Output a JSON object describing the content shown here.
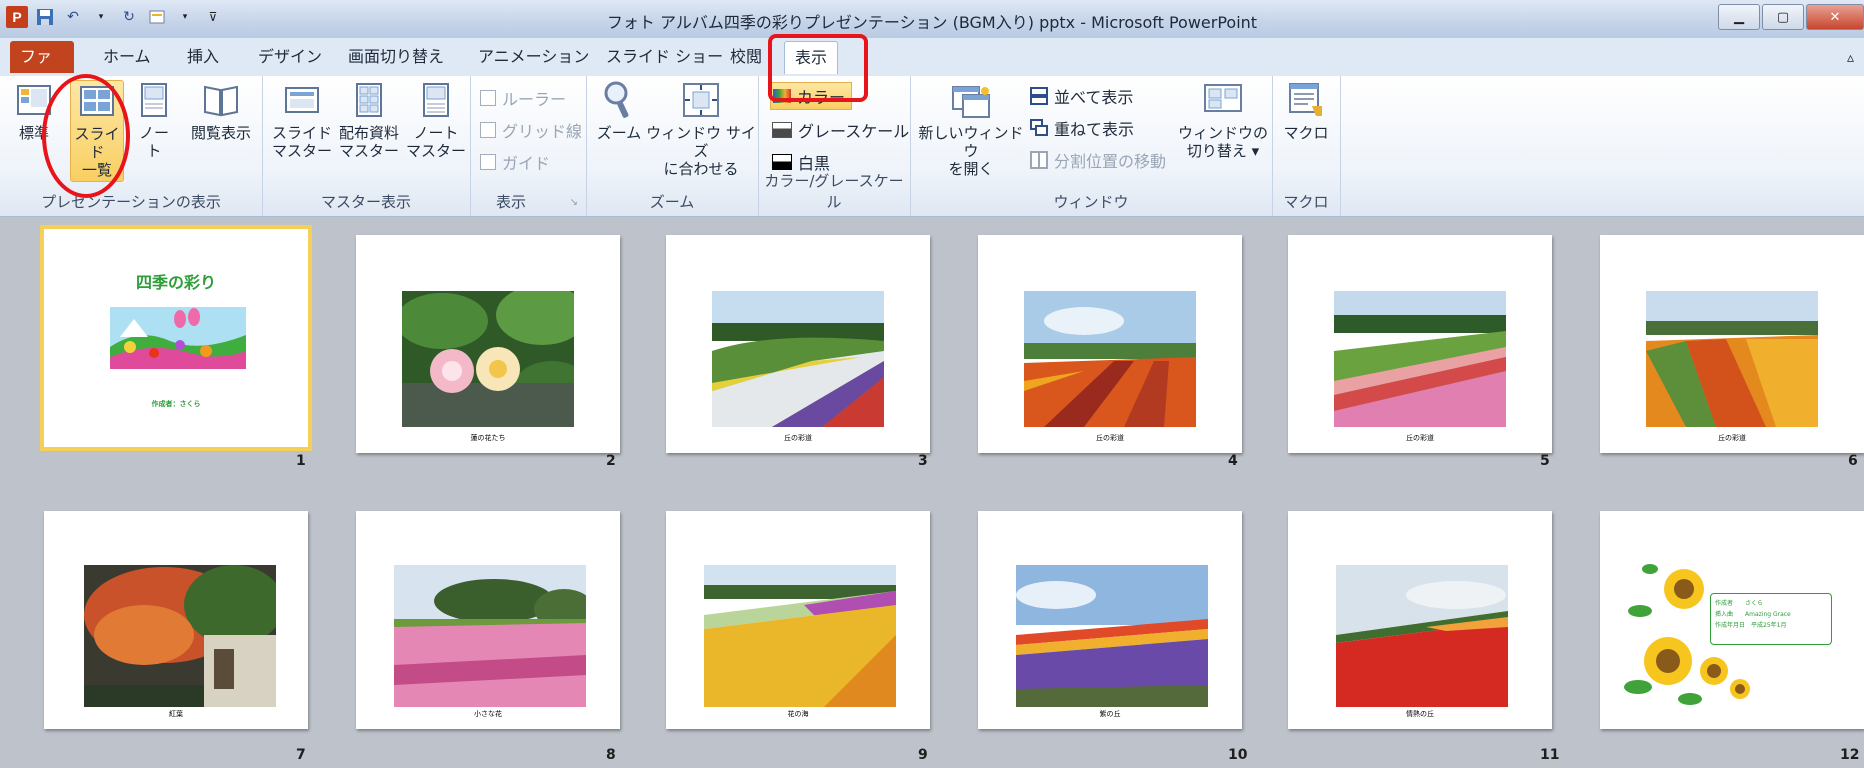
{
  "window": {
    "title": "フォト アルバム四季の彩りプレゼンテーション (BGM入り) pptx - Microsoft PowerPoint",
    "app_icon": "P"
  },
  "tabs": [
    {
      "label": "ファイル"
    },
    {
      "label": "ホーム"
    },
    {
      "label": "挿入"
    },
    {
      "label": "デザイン"
    },
    {
      "label": "画面切り替え"
    },
    {
      "label": "アニメーション"
    },
    {
      "label": "スライド ショー"
    },
    {
      "label": "校閲"
    },
    {
      "label": "表示"
    }
  ],
  "ribbon": {
    "pres_view": {
      "label": "プレゼンテーションの表示",
      "normal": "標準",
      "sorter_1": "スライド",
      "sorter_2": "一覧",
      "notes": "ノート",
      "reading": "閲覧表示"
    },
    "master_view": {
      "label": "マスター表示",
      "slide_master_1": "スライド",
      "slide_master_2": "マスター",
      "handout_1": "配布資料",
      "handout_2": "マスター",
      "notes_master_1": "ノート",
      "notes_master_2": "マスター"
    },
    "show": {
      "label": "表示",
      "ruler": "ルーラー",
      "grid": "グリッド線",
      "guides": "ガイド"
    },
    "zoom": {
      "label": "ズーム",
      "zoom": "ズーム",
      "fit_1": "ウィンドウ サイズ",
      "fit_2": "に合わせる"
    },
    "color": {
      "label": "カラー/グレースケール",
      "color": "カラー",
      "grayscale": "グレースケール",
      "bw": "白黒"
    },
    "window": {
      "label": "ウィンドウ",
      "new_1": "新しいウィンドウ",
      "new_2": "を開く",
      "arrange": "並べて表示",
      "cascade": "重ねて表示",
      "split": "分割位置の移動",
      "switch_1": "ウィンドウの",
      "switch_2": "切り替え ▾"
    },
    "macro": {
      "label": "マクロ",
      "macro": "マクロ"
    }
  },
  "slide1": {
    "title": "四季の彩り",
    "author": "作成者：さくら"
  },
  "slide12": {
    "line1": "作成者　　さくら",
    "line2": "挿入曲　　Amazing Grace",
    "line3": "作成年月日　平成25年1月"
  },
  "slides": [
    {
      "num": "1",
      "caption": ""
    },
    {
      "num": "2",
      "caption": "蓮の花たち"
    },
    {
      "num": "3",
      "caption": "丘の彩道"
    },
    {
      "num": "4",
      "caption": "丘の彩道"
    },
    {
      "num": "5",
      "caption": "丘の彩道"
    },
    {
      "num": "6",
      "caption": "丘の彩道"
    },
    {
      "num": "7",
      "caption": "紅葉"
    },
    {
      "num": "8",
      "caption": "小さな花"
    },
    {
      "num": "9",
      "caption": "花の海"
    },
    {
      "num": "10",
      "caption": "紫の丘"
    },
    {
      "num": "11",
      "caption": "情熱の丘"
    },
    {
      "num": "12",
      "caption": ""
    }
  ]
}
